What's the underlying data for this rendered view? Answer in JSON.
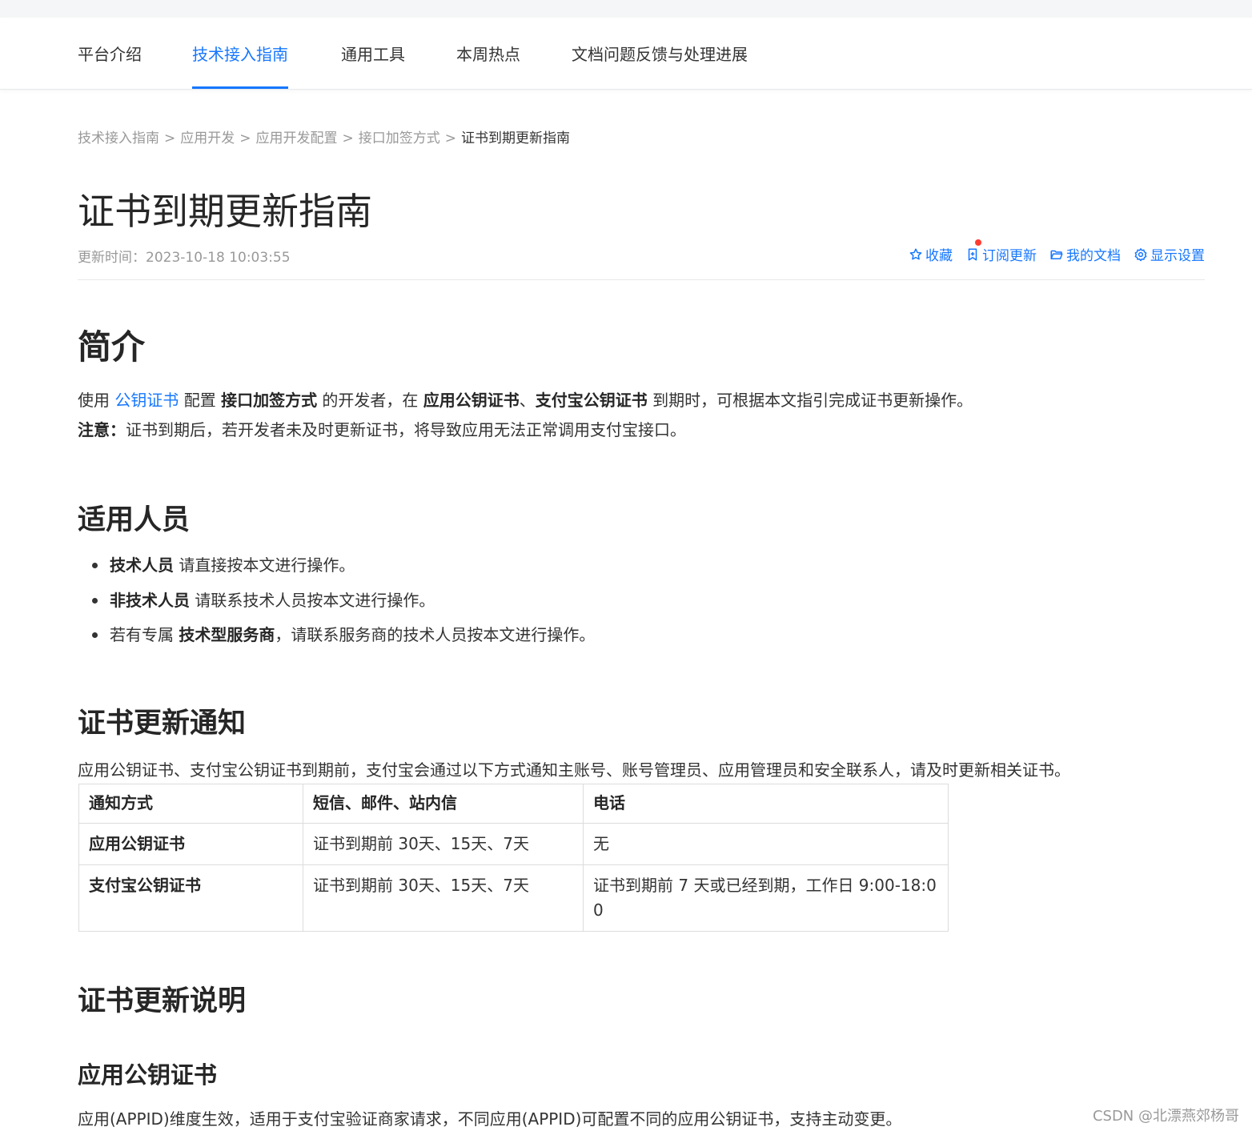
{
  "nav": {
    "items": [
      {
        "label": "平台介绍"
      },
      {
        "label": "技术接入指南"
      },
      {
        "label": "通用工具"
      },
      {
        "label": "本周热点"
      },
      {
        "label": "文档问题反馈与处理进展"
      }
    ],
    "active": "技术接入指南"
  },
  "breadcrumb": {
    "items": [
      "技术接入指南",
      "应用开发",
      "应用开发配置",
      "接口加签方式"
    ],
    "separator": ">",
    "current": "证书到期更新指南"
  },
  "page": {
    "title": "证书到期更新指南",
    "updated_label": "更新时间：",
    "updated_value": "2023-10-18 10:03:55"
  },
  "actions": {
    "favorite": "收藏",
    "subscribe": "订阅更新",
    "my_docs": "我的文档",
    "display_settings": "显示设置"
  },
  "intro": {
    "heading": "简介",
    "p1_a": "使用 ",
    "p1_link": "公钥证书",
    "p1_b": " 配置 ",
    "p1_bold1": "接口加签方式",
    "p1_c": " 的开发者，在 ",
    "p1_bold2": "应用公钥证书",
    "p1_d": "、",
    "p1_bold3": "支付宝公钥证书",
    "p1_e": " 到期时，可根据本文指引完成证书更新操作。",
    "note_label": "注意：",
    "note_text": "证书到期后，若开发者未及时更新证书，将导致应用无法正常调用支付宝接口。"
  },
  "audience": {
    "heading": "适用人员",
    "items": [
      {
        "pre": "",
        "bold": "技术人员",
        "post": " 请直接按本文进行操作。"
      },
      {
        "pre": "",
        "bold": "非技术人员",
        "post": " 请联系技术人员按本文进行操作。"
      },
      {
        "pre": "若有专属 ",
        "bold": "技术型服务商",
        "post": "，请联系服务商的技术人员按本文进行操作。"
      }
    ]
  },
  "notification": {
    "heading": "证书更新通知",
    "text": "应用公钥证书、支付宝公钥证书到期前，支付宝会通过以下方式通知主账号、账号管理员、应用管理员和安全联系人，请及时更新相关证书。",
    "table": {
      "headers": [
        "通知方式",
        "短信、邮件、站内信",
        "电话"
      ],
      "rows": [
        [
          "应用公钥证书",
          "证书到期前 30天、15天、7天",
          "无"
        ],
        [
          "支付宝公钥证书",
          "证书到期前 30天、15天、7天",
          "证书到期前 7 天或已经到期，工作日 9:00-18:00"
        ]
      ]
    }
  },
  "explanation": {
    "heading": "证书更新说明",
    "subheading": "应用公钥证书",
    "text": "应用(APPID)维度生效，适用于支付宝验证商家请求，不同应用(APPID)可配置不同的应用公钥证书，支持主动变更。"
  },
  "watermark": "CSDN @北漂燕郊杨哥",
  "colors": {
    "accent": "#1677ff",
    "text": "#333333",
    "muted": "#999999",
    "dot": "#ff3b30"
  }
}
